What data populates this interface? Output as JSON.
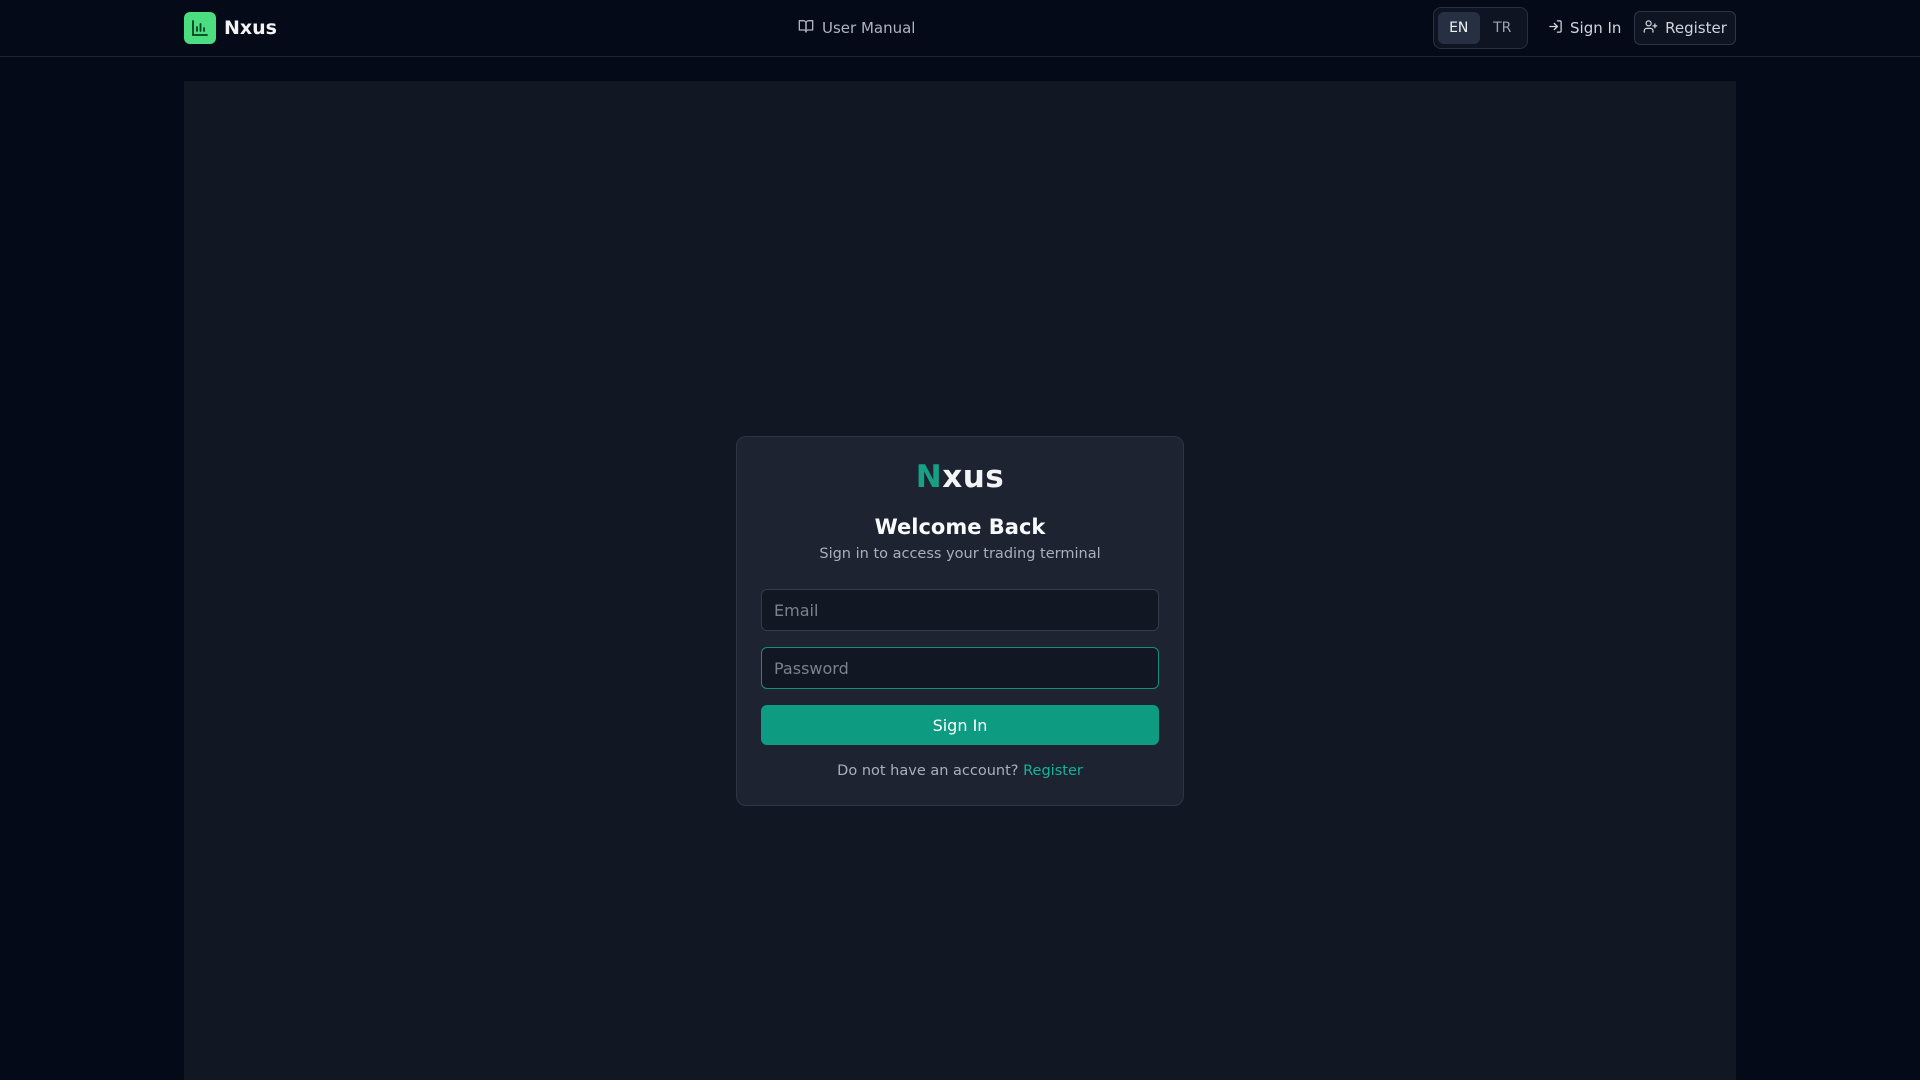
{
  "colors": {
    "accent": "#0d9b82",
    "accent_text": "#14b39a",
    "brand_logo_bg": "#4ade80",
    "page_bg": "#050a18",
    "panel_bg": "#111723",
    "card_bg": "#1d2330"
  },
  "topbar": {
    "brand": {
      "icon": "bar-chart-icon",
      "name": "Nxus"
    },
    "manual": {
      "icon": "book-open-icon",
      "label": "User Manual"
    },
    "language": {
      "options": [
        "EN",
        "TR"
      ],
      "selected": "EN"
    },
    "sign_in": {
      "icon": "log-in-icon",
      "label": "Sign In"
    },
    "register": {
      "icon": "user-plus-icon",
      "label": "Register"
    }
  },
  "login": {
    "logo_accent": "N",
    "logo_rest": "xus",
    "title": "Welcome Back",
    "subtitle": "Sign in to access your trading terminal",
    "email": {
      "value": "",
      "placeholder": "Email"
    },
    "password": {
      "value": "",
      "placeholder": "Password"
    },
    "submit_label": "Sign In",
    "footer_text": "Do not have an account?",
    "footer_link": "Register"
  }
}
